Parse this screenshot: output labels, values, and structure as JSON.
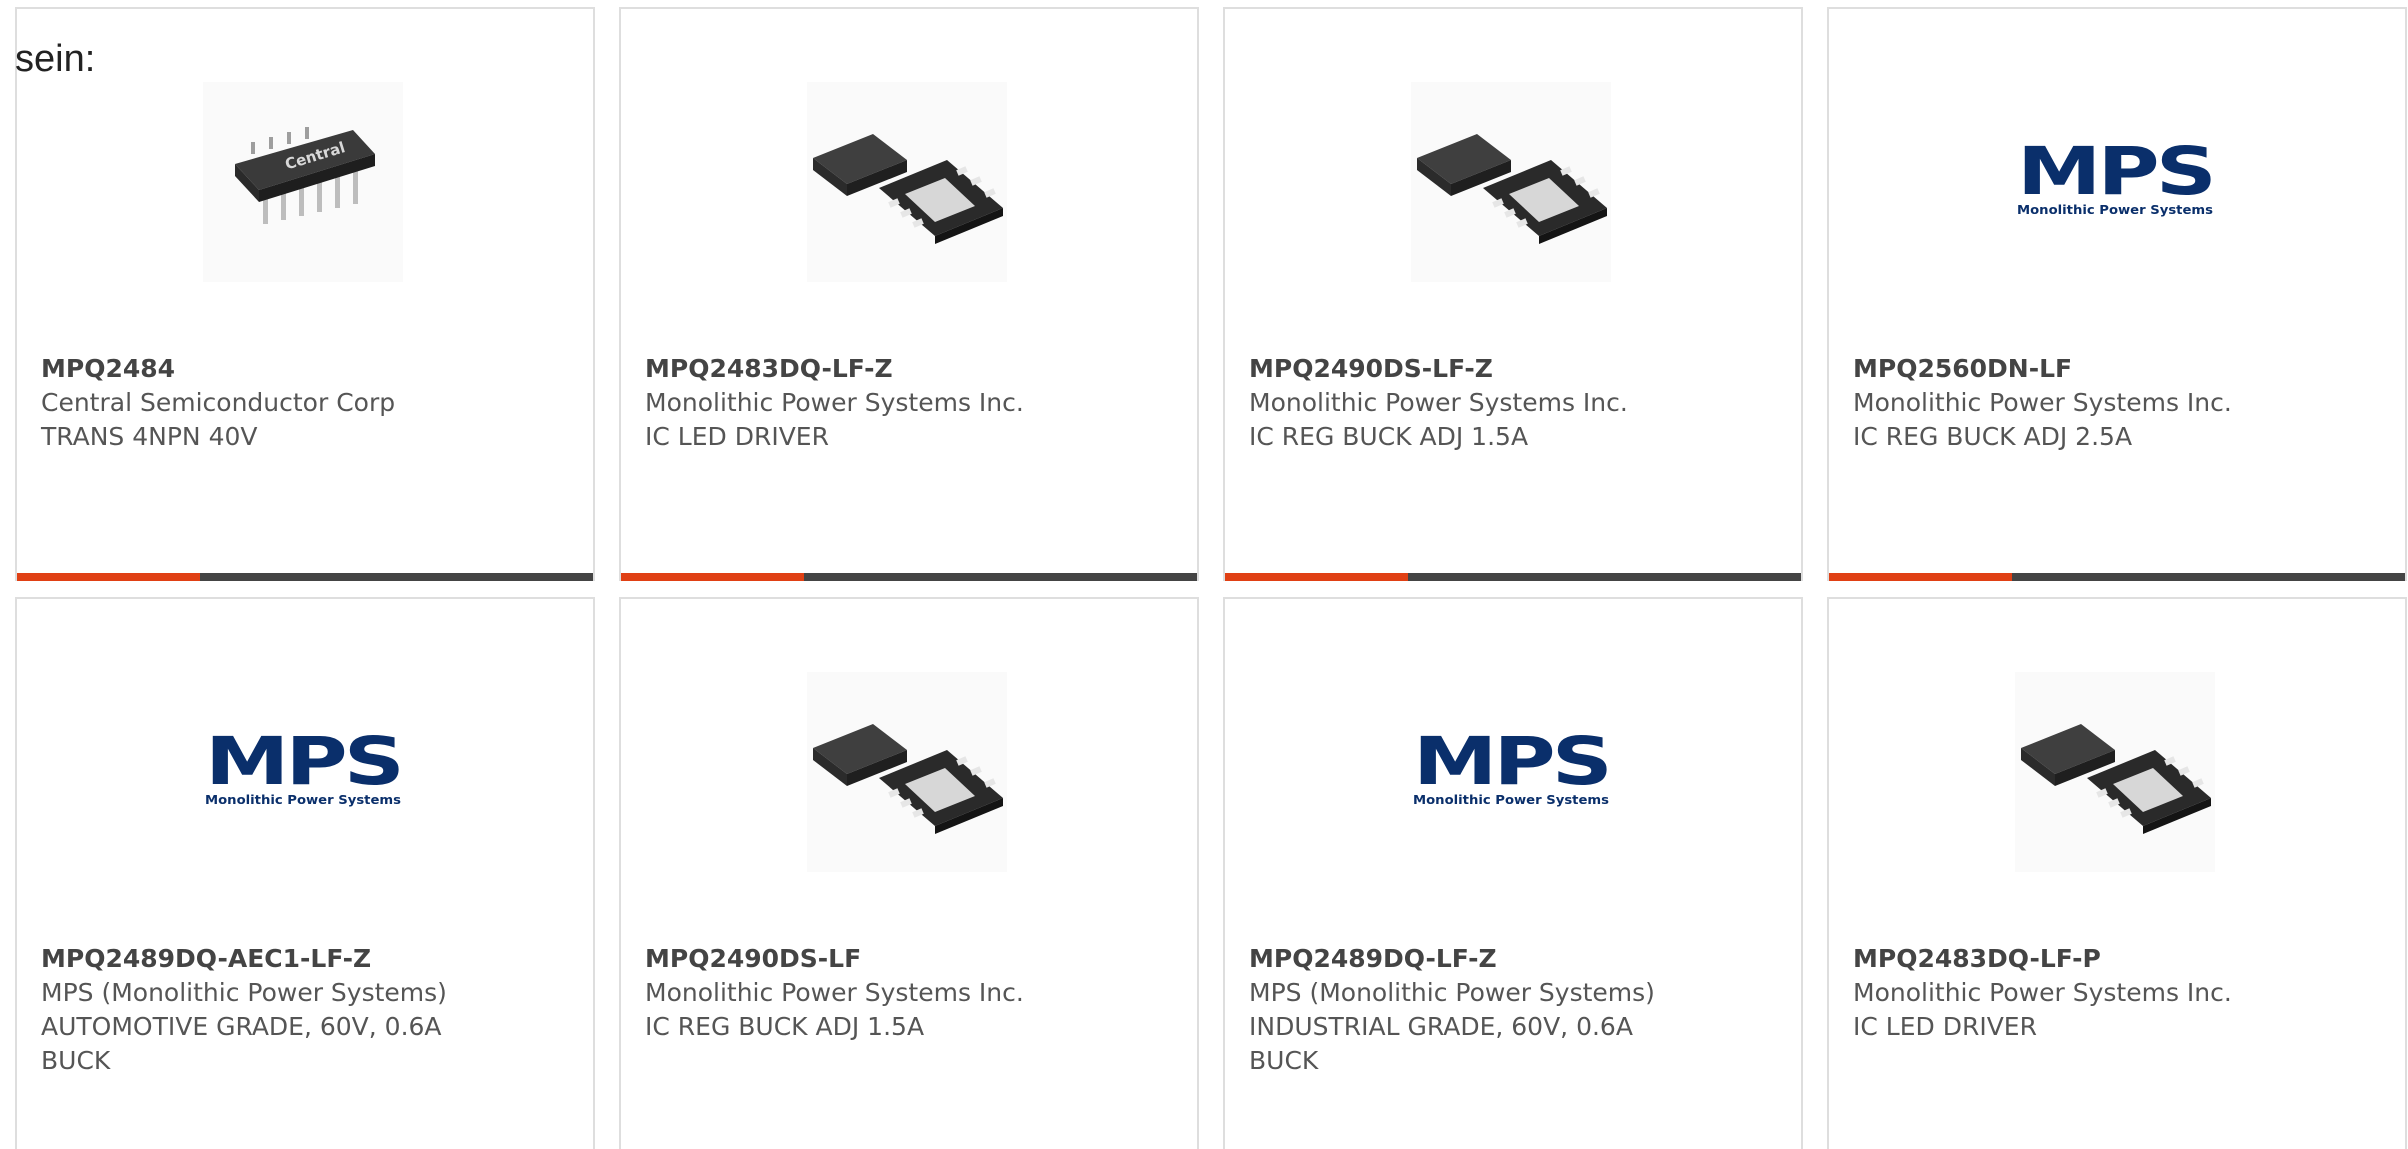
{
  "intro_text": "sein:",
  "colors": {
    "accent": "#e04014",
    "bar": "#444444",
    "border": "#dedede",
    "mps_blue": "#0a2f6b"
  },
  "products": [
    {
      "part": "MPQ2484",
      "manufacturer": "Central Semiconductor Corp",
      "description": "TRANS 4NPN 40V",
      "image": "dip-chip-icon"
    },
    {
      "part": "MPQ2483DQ-LF-Z",
      "manufacturer": "Monolithic Power Systems Inc.",
      "description": "IC LED DRIVER",
      "image": "qfn-chip-icon"
    },
    {
      "part": "MPQ2490DS-LF-Z",
      "manufacturer": "Monolithic Power Systems Inc.",
      "description": "IC REG BUCK ADJ 1.5A",
      "image": "qfn-chip-icon"
    },
    {
      "part": "MPQ2560DN-LF",
      "manufacturer": "Monolithic Power Systems Inc.",
      "description": "IC REG BUCK ADJ 2.5A",
      "image": "mps-logo"
    },
    {
      "part": "MPQ2489DQ-AEC1-LF-Z",
      "manufacturer": "MPS (Monolithic Power Systems)",
      "description": "AUTOMOTIVE GRADE, 60V, 0.6A BUCK",
      "image": "mps-logo"
    },
    {
      "part": "MPQ2490DS-LF",
      "manufacturer": "Monolithic Power Systems Inc.",
      "description": "IC REG BUCK ADJ 1.5A",
      "image": "qfn-chip-icon"
    },
    {
      "part": "MPQ2489DQ-LF-Z",
      "manufacturer": "MPS (Monolithic Power Systems)",
      "description": "INDUSTRIAL GRADE, 60V, 0.6A BUCK",
      "image": "mps-logo"
    },
    {
      "part": "MPQ2483DQ-LF-P",
      "manufacturer": "Monolithic Power Systems Inc.",
      "description": "IC LED DRIVER",
      "image": "qfn-chip-icon"
    }
  ],
  "logo": {
    "brand": "MPS",
    "tagline": "Monolithic Power Systems",
    "dip_marking": "Central"
  }
}
